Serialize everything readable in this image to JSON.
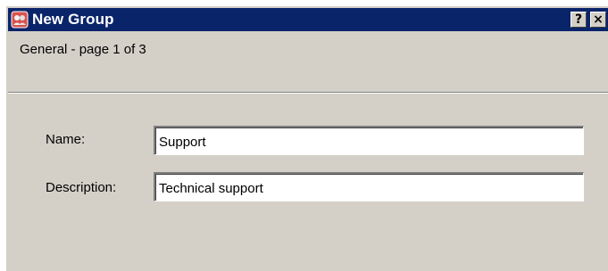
{
  "window": {
    "title": "New Group",
    "help_button": "?",
    "close_button": "×"
  },
  "page": {
    "heading": "General - page 1 of 3"
  },
  "form": {
    "name": {
      "label": "Name:",
      "value": "Support"
    },
    "description": {
      "label": "Description:",
      "value": "Technical support"
    }
  },
  "colors": {
    "titlebar": "#0a246a",
    "dialog_face": "#d4d0c8"
  },
  "icons": {
    "app": "group-app-icon"
  }
}
